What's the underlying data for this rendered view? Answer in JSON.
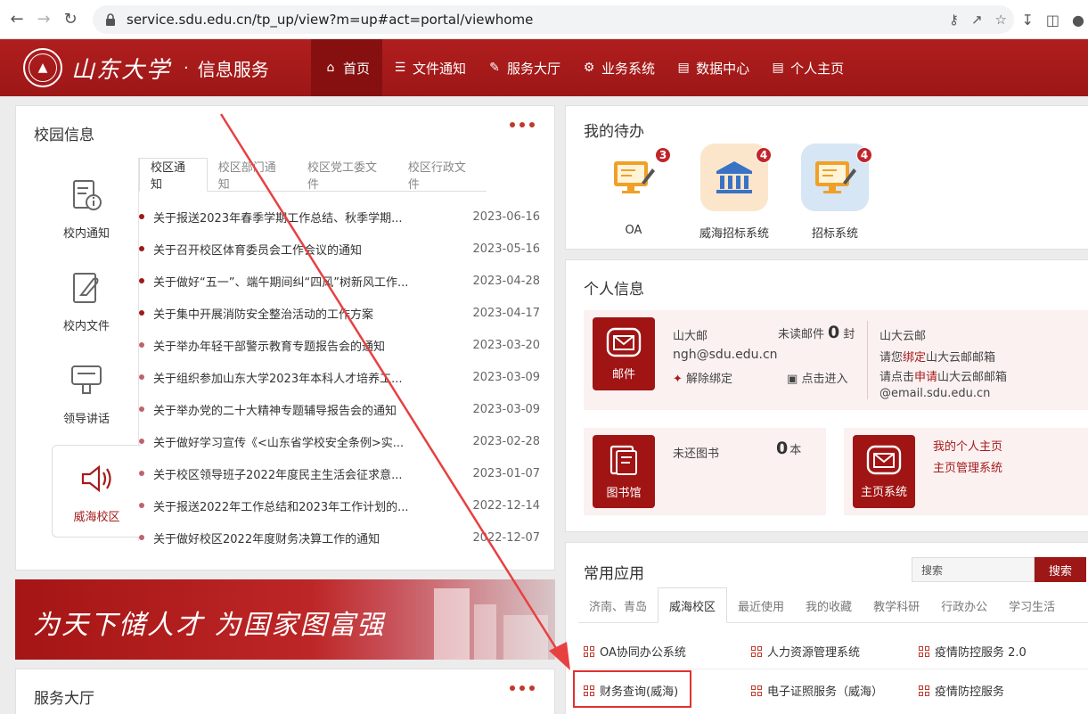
{
  "browser": {
    "url": "service.sdu.edu.cn/tp_up/view?m=up#act=portal/viewhome"
  },
  "header": {
    "logo_text": "山东大学",
    "separator": "·",
    "subtitle": "信息服务",
    "nav": [
      {
        "label": "首页",
        "icon": "home-icon"
      },
      {
        "label": "文件通知",
        "icon": "list-icon"
      },
      {
        "label": "服务大厅",
        "icon": "edit-icon"
      },
      {
        "label": "业务系统",
        "icon": "gear-icon"
      },
      {
        "label": "数据中心",
        "icon": "doc-icon"
      },
      {
        "label": "个人主页",
        "icon": "doc-icon"
      }
    ]
  },
  "campus": {
    "title": "校园信息",
    "categories": [
      {
        "label": "校内通知",
        "icon": "notice-icon"
      },
      {
        "label": "校内文件",
        "icon": "file-icon"
      },
      {
        "label": "领导讲话",
        "icon": "speech-icon"
      },
      {
        "label": "威海校区",
        "icon": "speaker-icon"
      }
    ],
    "tabs": [
      "校区通知",
      "校区部门通知",
      "校区党工委文件",
      "校区行政文件"
    ],
    "news": [
      {
        "title": "关于报送2023年春季学期工作总结、秋季学期...",
        "date": "2023-06-16"
      },
      {
        "title": "关于召开校区体育委员会工作会议的通知",
        "date": "2023-05-16"
      },
      {
        "title": "关于做好“五一”、端午期间纠“四风”树新风工作...",
        "date": "2023-04-28"
      },
      {
        "title": "关于集中开展消防安全整治活动的工作方案",
        "date": "2023-04-17"
      },
      {
        "title": "关于举办年轻干部警示教育专题报告会的通知",
        "date": "2023-03-20"
      },
      {
        "title": "关于组织参加山东大学2023年本科人才培养工...",
        "date": "2023-03-09"
      },
      {
        "title": "关于举办党的二十大精神专题辅导报告会的通知",
        "date": "2023-03-09"
      },
      {
        "title": "关于做好学习宣传《<山东省学校安全条例>实...",
        "date": "2023-02-28"
      },
      {
        "title": "关于校区领导班子2022年度民主生活会征求意...",
        "date": "2023-01-07"
      },
      {
        "title": "关于报送2022年工作总结和2023年工作计划的...",
        "date": "2022-12-14"
      },
      {
        "title": "关于做好校区2022年度财务决算工作的通知",
        "date": "2022-12-07"
      }
    ]
  },
  "banner": {
    "text": "为天下储人才 为国家图富强"
  },
  "service_hall": {
    "title": "服务大厅"
  },
  "todo": {
    "title": "我的待办",
    "items": [
      {
        "label": "OA",
        "badge": "3",
        "icon": "oa-icon"
      },
      {
        "label": "威海招标系统",
        "badge": "4",
        "icon": "bank-icon"
      },
      {
        "label": "招标系统",
        "badge": "4",
        "icon": "tender-icon"
      }
    ]
  },
  "personal": {
    "title": "个人信息",
    "mail": {
      "icon_label": "邮件",
      "name": "山大邮",
      "unread_label": "未读邮件",
      "unread_count": "0",
      "unread_unit": "封",
      "address": "ngh@sdu.edu.cn",
      "unbind": "解除绑定",
      "enter": "点击进入",
      "cloud_title": "山大云邮",
      "cloud_line1_a": "请您",
      "cloud_line1_b": "绑定",
      "cloud_line1_c": "山大云邮邮箱",
      "cloud_line2_a": "请点击",
      "cloud_line2_b": "申请",
      "cloud_line2_c": "山大云邮邮箱",
      "cloud_line3": "@email.sdu.edu.cn"
    },
    "library": {
      "icon_label": "图书馆",
      "label": "未还图书",
      "count": "0",
      "unit": "本"
    },
    "homepage": {
      "icon_label": "主页系统",
      "link1": "我的个人主页",
      "link2": "主页管理系统"
    }
  },
  "apps": {
    "title": "常用应用",
    "search_placeholder": "搜索",
    "search_button": "搜索",
    "tabs": [
      "济南、青岛",
      "威海校区",
      "最近使用",
      "我的收藏",
      "教学科研",
      "行政办公",
      "学习生活"
    ],
    "row1": [
      "OA协同办公系统",
      "人力资源管理系统",
      "疫情防控服务 2.0"
    ],
    "row2": [
      "财务查询(威海)",
      "电子证照服务（威海）",
      "疫情防控服务"
    ]
  },
  "colors": {
    "brand": "#a61b1b",
    "accent": "#c0252b"
  }
}
